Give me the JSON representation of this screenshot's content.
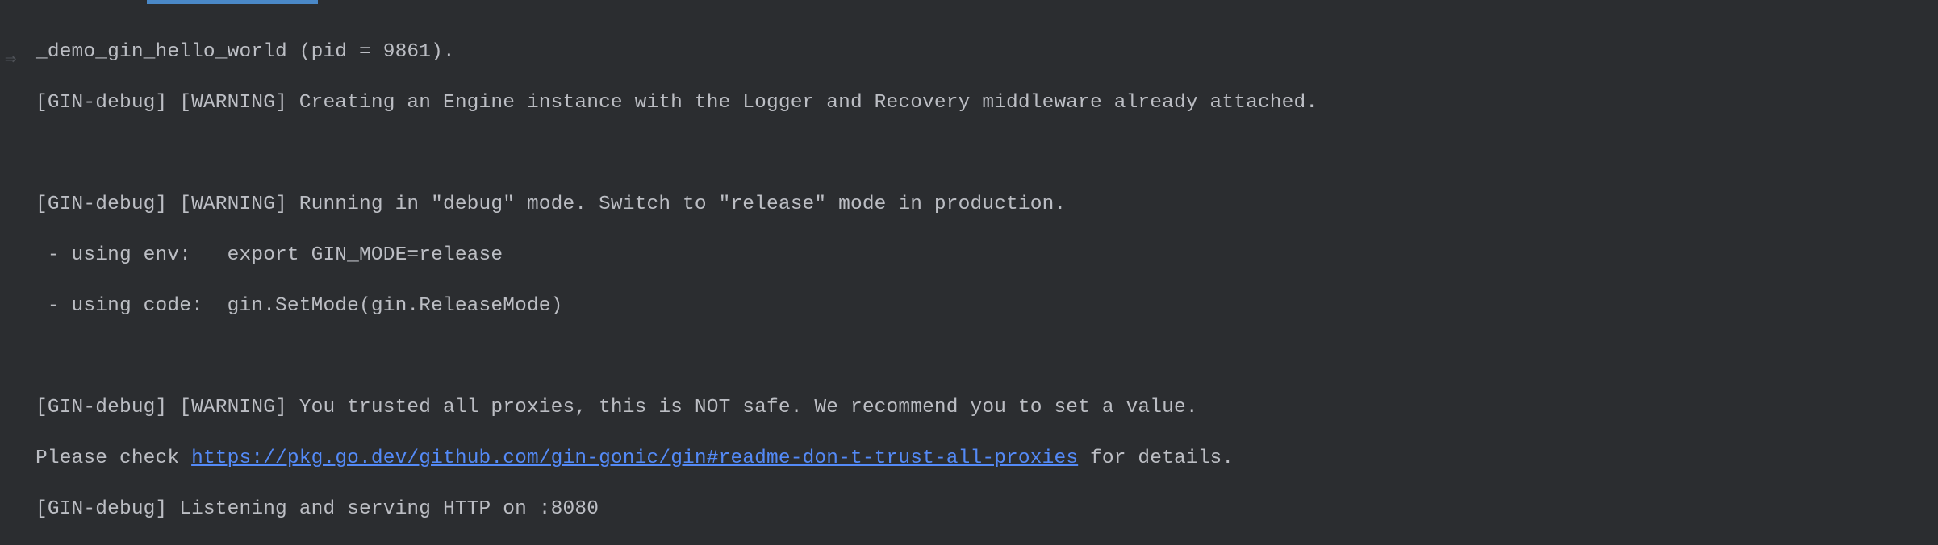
{
  "gutter": {
    "marker": "⇒"
  },
  "console": {
    "lines": [
      "_demo_gin_hello_world (pid = 9861).",
      "[GIN-debug] [WARNING] Creating an Engine instance with the Logger and Recovery middleware already attached.",
      "",
      "[GIN-debug] [WARNING] Running in \"debug\" mode. Switch to \"release\" mode in production.",
      " - using env:   export GIN_MODE=release",
      " - using code:  gin.SetMode(gin.ReleaseMode)",
      "",
      "[GIN-debug] [WARNING] You trusted all proxies, this is NOT safe. We recommend you to set a value."
    ],
    "link_line": {
      "prefix": "Please check ",
      "url": "https://pkg.go.dev/github.com/gin-gonic/gin#readme-don-t-trust-all-proxies",
      "suffix": " for details."
    },
    "last_line": "[GIN-debug] Listening and serving HTTP on :8080"
  }
}
